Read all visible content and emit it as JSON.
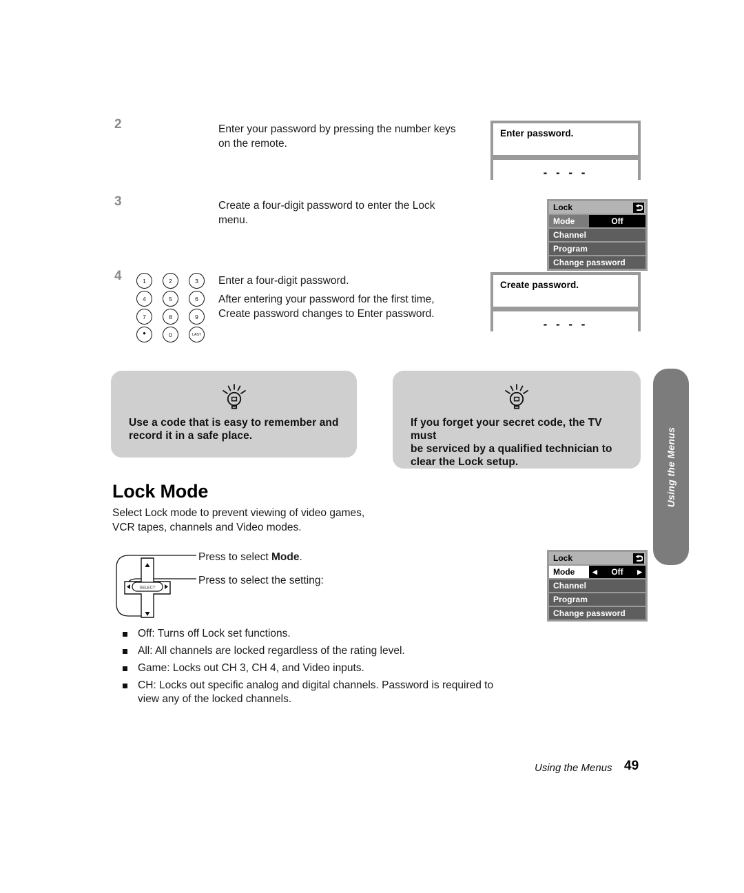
{
  "steps": [
    {
      "number": "2",
      "lines": [
        "Enter your password by pressing the number keys",
        "on the remote."
      ]
    },
    {
      "number": "3",
      "lines": [
        "Create a four-digit password to enter the Lock",
        "menu."
      ]
    },
    {
      "number": "4",
      "lines": [
        "Enter a four-digit password."
      ],
      "lines2": [
        "After entering your password for the first time,",
        "Create password changes to Enter password."
      ]
    }
  ],
  "keypad": {
    "keys": [
      "1",
      "2",
      "3",
      "4",
      "5",
      "6",
      "7",
      "8",
      "9",
      "•",
      "0",
      "LAST"
    ]
  },
  "osd_dialogs": [
    {
      "title": "Enter password.",
      "dashes": "- - - -"
    },
    {
      "title": "Create password.",
      "dashes": "- - - -"
    }
  ],
  "lock_menus": [
    {
      "header": "Lock",
      "back_icon": "return-arrow-icon",
      "mode_label": "Mode",
      "mode_value": "Off",
      "mode_left_arrow": "",
      "mode_right_arrow": "",
      "items": [
        "Channel",
        "Program",
        "Change password"
      ]
    },
    {
      "header": "Lock",
      "back_icon": "return-arrow-icon",
      "mode_label": "Mode",
      "mode_value": "Off",
      "mode_left_arrow": "◀",
      "mode_right_arrow": "▶",
      "items": [
        "Channel",
        "Program",
        "Change password"
      ]
    }
  ],
  "tips": [
    {
      "icon": "lightbulb-icon",
      "lines": [
        "Use a code that is easy to remember and",
        "record it in a safe place."
      ]
    },
    {
      "icon": "lightbulb-icon",
      "lines": [
        "If you forget your secret code, the TV must",
        "be serviced by a qualified technician to",
        "clear the Lock setup."
      ]
    }
  ],
  "section": {
    "heading": "Lock Mode",
    "intro": [
      "Select Lock mode to prevent viewing of video games,",
      "VCR tapes, channels and Video modes."
    ],
    "dpad": {
      "select_label": "SELECT",
      "callout_1_pre": "Press to select ",
      "callout_1_bold": "Mode",
      "callout_1_post": ".",
      "callout_2": "Press to select the setting:"
    },
    "bullets": [
      {
        "lines": [
          "Off: Turns off Lock set functions."
        ]
      },
      {
        "lines": [
          "All: All channels are locked regardless of the rating level."
        ]
      },
      {
        "lines": [
          "Game: Locks out CH 3, CH 4, and Video inputs."
        ]
      },
      {
        "lines": [
          "CH: Locks out specific analog and digital channels. Password is required to",
          "view any of the locked channels."
        ]
      }
    ]
  },
  "side_tab": {
    "label": "Using the Menus"
  },
  "footer": {
    "label": "Using the Menus",
    "page": "49"
  },
  "colors": {
    "tip_bg": "#cfcfcf",
    "osd_border": "#9a9a9a",
    "menu_bg": "#9a9a9a",
    "menu_header": "#b4b4b4",
    "menu_item": "#5e5e5e",
    "menu_mode": "#7c7c7c",
    "side_tab": "#7c7c7c",
    "step_number": "#8a8a8a"
  }
}
